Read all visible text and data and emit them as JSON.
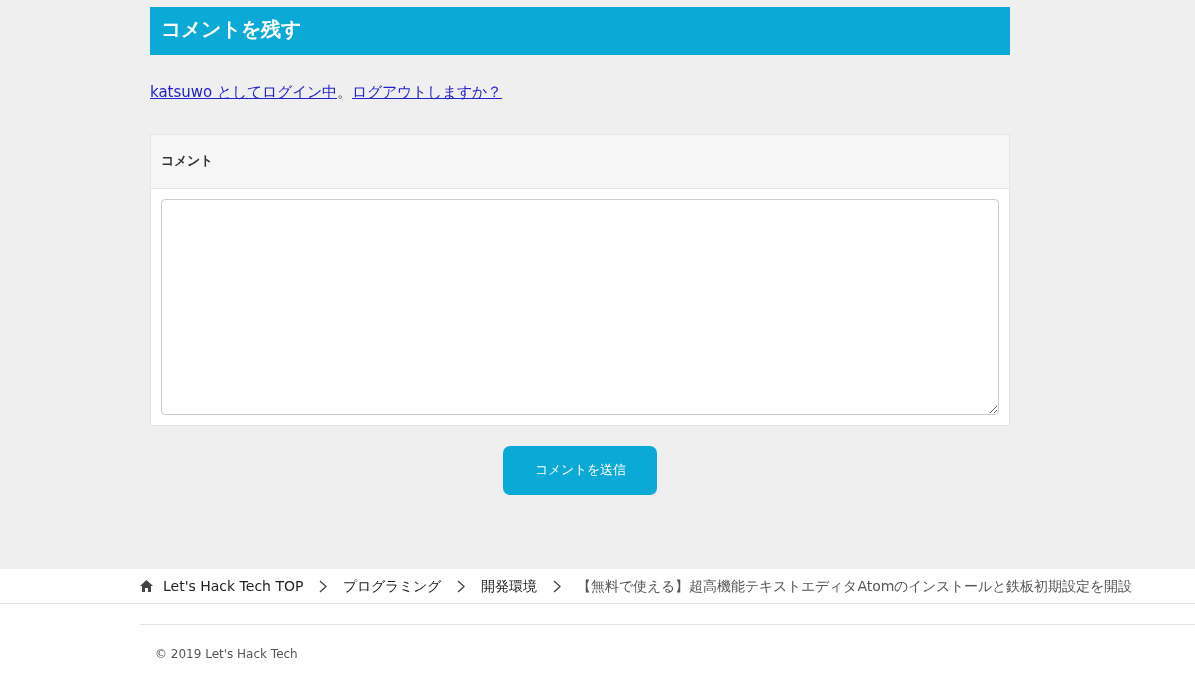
{
  "comment_section": {
    "title": "コメントを残す",
    "login_link": "katsuwo としてログイン中",
    "separator": "。",
    "logout_link": "ログアウトしますか？",
    "field_label": "コメント",
    "submit_button": "コメントを送信"
  },
  "breadcrumb": [
    {
      "label": "Let's Hack Tech TOP",
      "current": false
    },
    {
      "label": "プログラミング",
      "current": false
    },
    {
      "label": "開発環境",
      "current": false
    },
    {
      "label": "【無料で使える】超高機能テキストエディタAtomのインストールと鉄板初期設定を開設",
      "current": true
    }
  ],
  "footer": {
    "copyright": "© 2019 Let's Hack Tech"
  }
}
